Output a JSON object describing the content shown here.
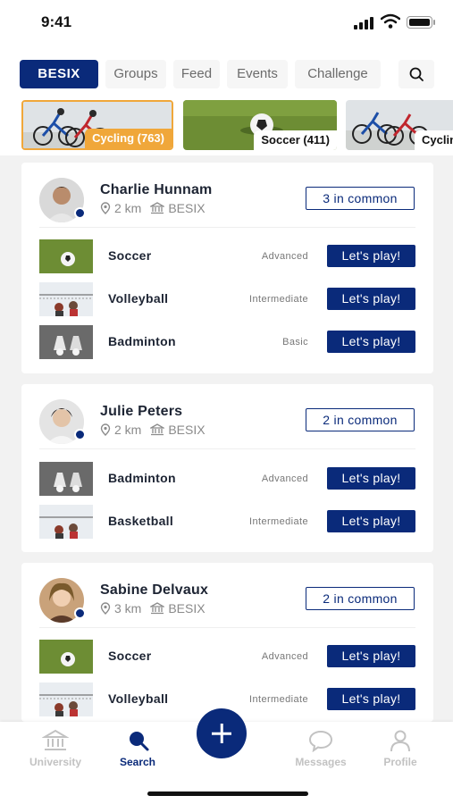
{
  "status_bar": {
    "time": "9:41"
  },
  "top_nav": {
    "tabs": [
      {
        "label": "BESIX",
        "active": true
      },
      {
        "label": "Groups",
        "active": false
      },
      {
        "label": "Feed",
        "active": false
      },
      {
        "label": "Events",
        "active": false
      },
      {
        "label": "Challenge",
        "active": false
      }
    ],
    "search_icon": "search-icon"
  },
  "categories": [
    {
      "label": "Cycling (763)",
      "selected": true
    },
    {
      "label": "Soccer (411)",
      "selected": false
    },
    {
      "label": "Cycling",
      "selected": false
    }
  ],
  "people": [
    {
      "name": "Charlie Hunnam",
      "distance": "2 km",
      "organisation": "BESIX",
      "common": "3 in common",
      "sports": [
        {
          "sport": "Soccer",
          "level": "Advanced",
          "action": "Let's play!"
        },
        {
          "sport": "Volleyball",
          "level": "Intermediate",
          "action": "Let's play!"
        },
        {
          "sport": "Badminton",
          "level": "Basic",
          "action": "Let's play!"
        }
      ]
    },
    {
      "name": "Julie Peters",
      "distance": "2 km",
      "organisation": "BESIX",
      "common": "2 in common",
      "sports": [
        {
          "sport": "Badminton",
          "level": "Advanced",
          "action": "Let's play!"
        },
        {
          "sport": "Basketball",
          "level": "Intermediate",
          "action": "Let's play!"
        }
      ]
    },
    {
      "name": "Sabine Delvaux",
      "distance": "3 km",
      "organisation": "BESIX",
      "common": "2 in common",
      "sports": [
        {
          "sport": "Soccer",
          "level": "Advanced",
          "action": "Let's play!"
        },
        {
          "sport": "Volleyball",
          "level": "Intermediate",
          "action": "Let's play!"
        }
      ]
    }
  ],
  "bottom_nav": {
    "items": [
      {
        "label": "University",
        "icon": "university-icon",
        "active": false
      },
      {
        "label": "Search",
        "icon": "search-icon",
        "active": true
      },
      {
        "label": "Messages",
        "icon": "chat-icon",
        "active": false
      },
      {
        "label": "Profile",
        "icon": "profile-icon",
        "active": false
      }
    ],
    "add_icon": "plus-icon"
  },
  "colors": {
    "primary": "#0a2a7a",
    "accent": "#f0a73a",
    "background": "#f2f2f2"
  }
}
